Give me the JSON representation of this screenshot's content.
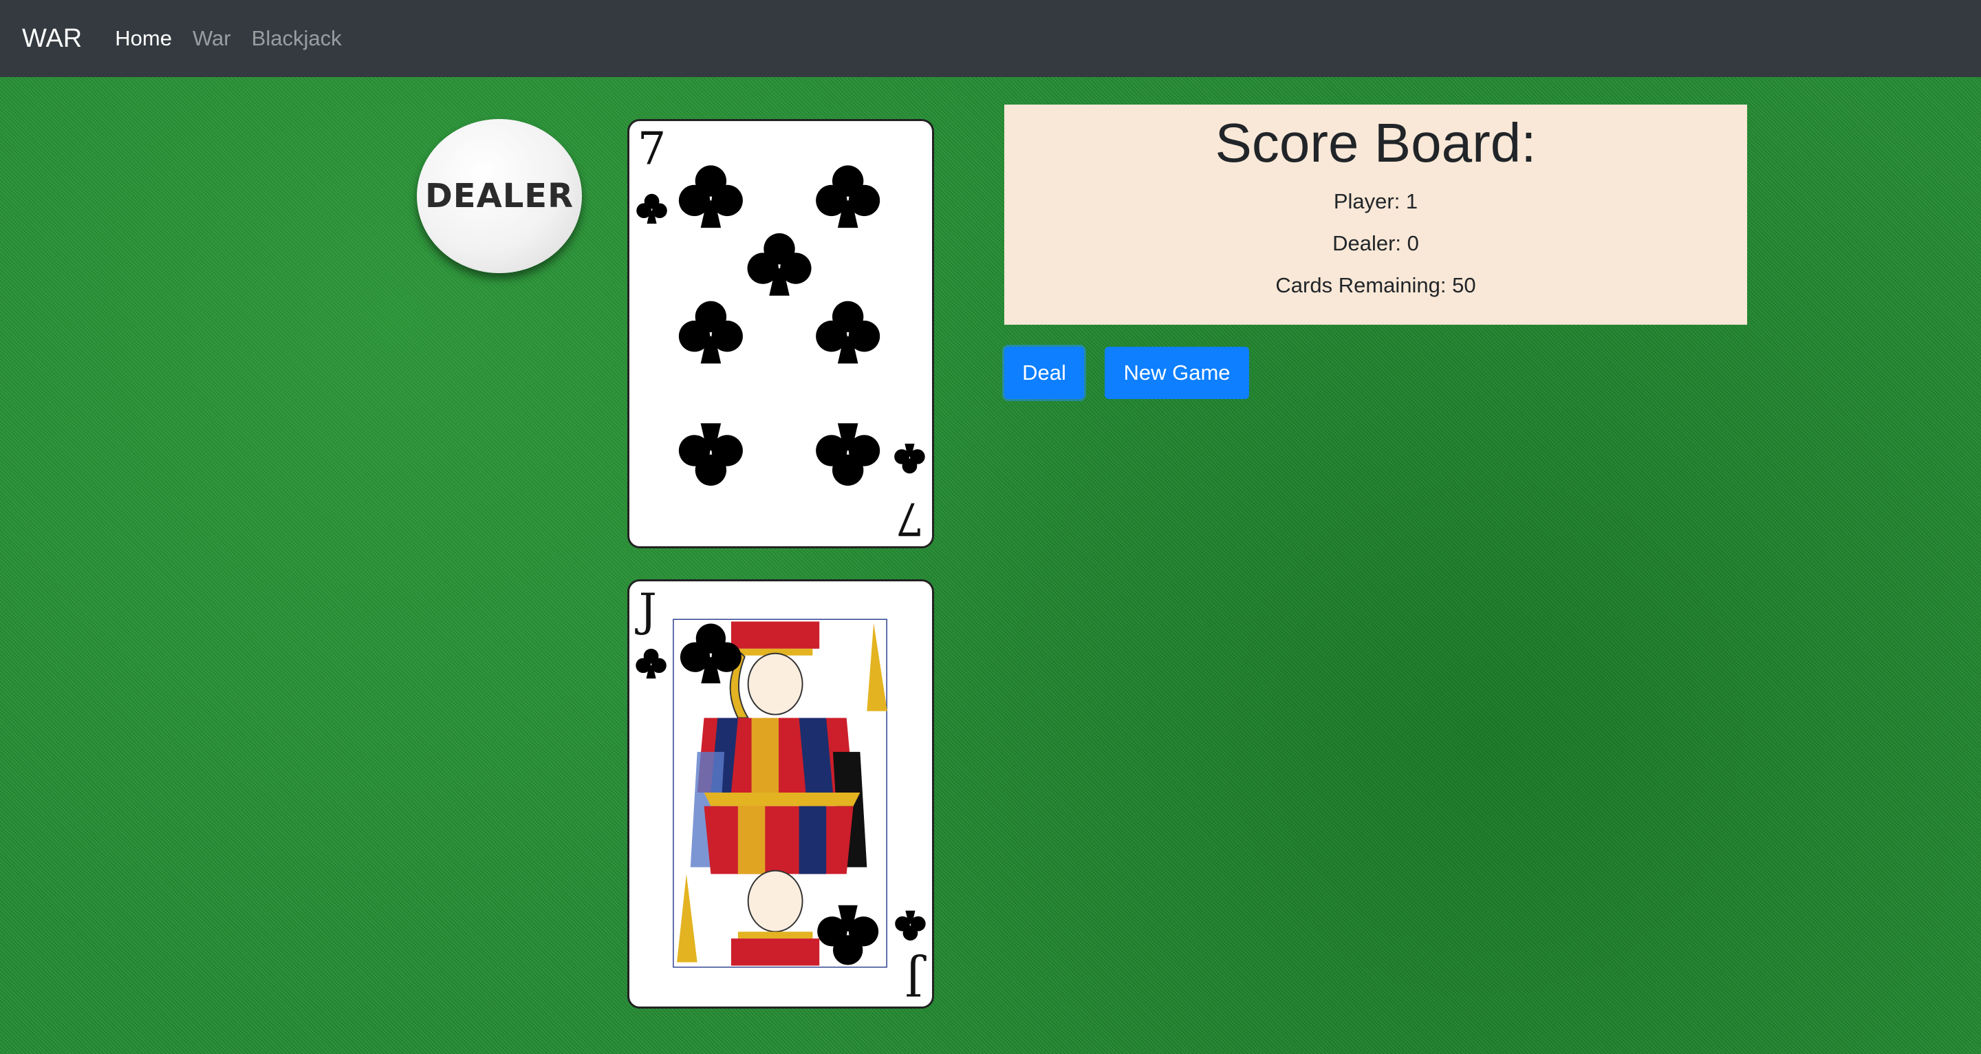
{
  "navbar": {
    "brand": "WAR",
    "links": [
      {
        "label": "Home",
        "active": true
      },
      {
        "label": "War",
        "active": false
      },
      {
        "label": "Blackjack",
        "active": false
      }
    ]
  },
  "dealer_chip": {
    "label": "DEALER"
  },
  "cards": [
    {
      "rank": "7",
      "suit": "clubs",
      "icon": "club-icon"
    },
    {
      "rank": "J",
      "suit": "clubs",
      "icon": "jack-face-art"
    }
  ],
  "scoreboard": {
    "title": "Score Board:",
    "player": "Player: 1",
    "dealer": "Dealer: 0",
    "cards_remaining": "Cards Remaining: 50"
  },
  "buttons": {
    "deal": "Deal",
    "new_game": "New Game"
  },
  "colors": {
    "navbar": "#343a40",
    "felt": "#1f8a2e",
    "scoreboard_bg": "#f9e8d7",
    "button": "#0d7fff"
  }
}
